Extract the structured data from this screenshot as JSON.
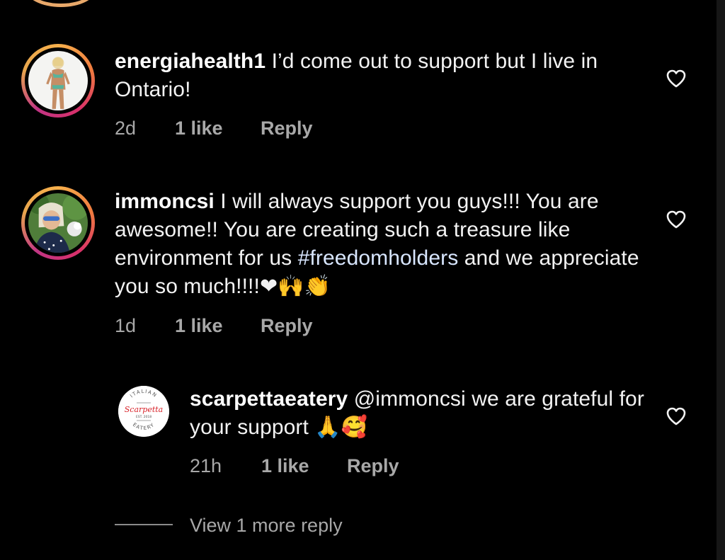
{
  "comments": [
    {
      "username": "energiahealth1",
      "text": " I’d come out to support but I live in Ontario!",
      "time": "2d",
      "likes": "1 like",
      "reply": "Reply"
    },
    {
      "username": "immoncsi",
      "text_before": " I will always support you guys!!! You are awesome!! You are creating such a treasure like environment for us ",
      "hashtag": "#freedomholders",
      "text_after": " and we appreciate you so much!!!!",
      "emojis": "❤🙌👏",
      "time": "1d",
      "likes": "1 like",
      "reply": "Reply"
    }
  ],
  "reply": {
    "username": "scarpettaeatery",
    "text": " @immoncsi we are grateful for your support ",
    "emojis": "🙏🥰",
    "time": "21h",
    "likes": "1 like",
    "reply": "Reply",
    "logo_text": {
      "top": "ITALIAN",
      "script": "Scarpetta",
      "est": "EST. 2018",
      "bottom": "EATERY"
    }
  },
  "view_more": "View 1 more reply",
  "colors": {
    "background": "#000000",
    "text": "#f2f2f2",
    "meta": "#a8a8a8",
    "hashtag": "#d8e6ff",
    "ring_gradient": [
      "#f7b04c",
      "#d9306a",
      "#c13584"
    ],
    "logo_red": "#d8232a"
  },
  "icons": {
    "like": "heart-outline-icon"
  }
}
